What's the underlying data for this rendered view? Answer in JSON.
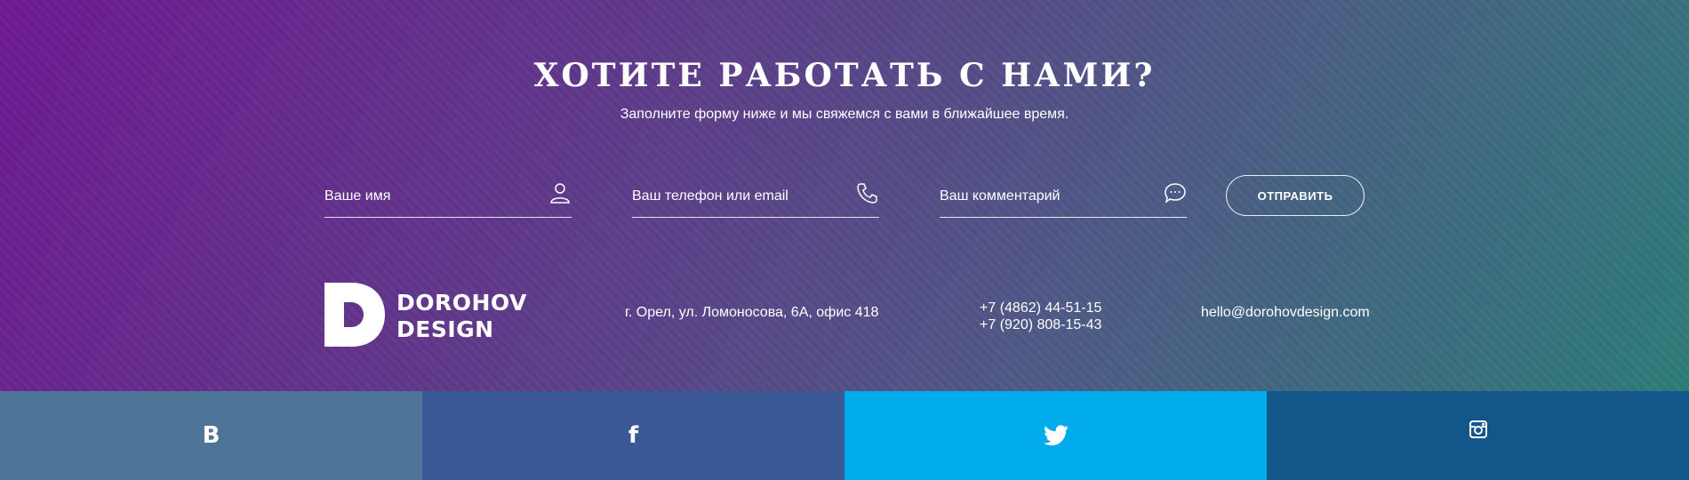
{
  "header": {
    "title": "ХОТИТЕ РАБОТАТЬ С НАМИ?",
    "subtitle": "Заполните форму ниже и мы свяжемся с вами в ближайшее время."
  },
  "form": {
    "name_placeholder": "Ваше имя",
    "contact_placeholder": "Ваш телефон или email",
    "comment_placeholder": "Ваш комментарий",
    "submit_label": "ОТПРАВИТЬ"
  },
  "footer": {
    "logo_line1": "DOROHOV",
    "logo_line2": "DESIGN",
    "address": "г. Орел, ул. Ломоносова, 6А, офис 418",
    "phone1": "+7 (4862) 44-51-15",
    "phone2": "+7 (920) 808-15-43",
    "email": "hello@dorohovdesign.com"
  },
  "social": {
    "vk_label": "B",
    "fb_label": "f",
    "twitter_icon": "twitter-icon",
    "instagram_icon": "instagram-icon",
    "colors": {
      "vk": "#4e7497",
      "fb": "#3b5896",
      "twitter": "#00abec",
      "instagram": "#135689"
    }
  },
  "icons": {
    "name": "user-icon",
    "contact": "phone-icon",
    "comment": "chat-bubble-icon"
  },
  "colors": {
    "gradient_start": "#6e1a92",
    "gradient_end": "#2d7d7a"
  }
}
